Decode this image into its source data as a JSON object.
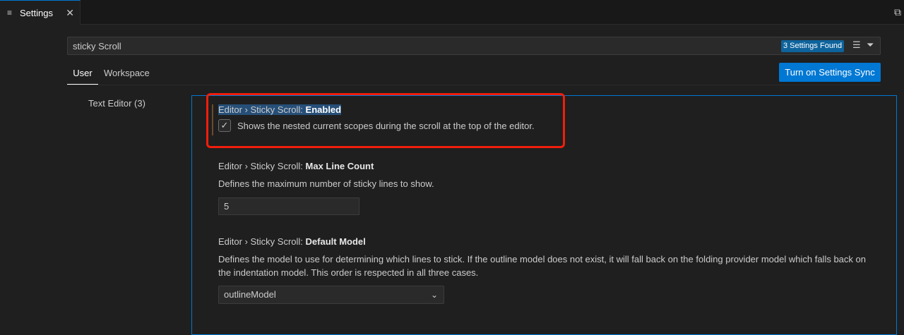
{
  "tab": {
    "icon": "settings-lines-icon",
    "label": "Settings",
    "close_icon": "close-icon"
  },
  "editor_actions": {
    "split_icon": "open-settings-json-icon"
  },
  "search": {
    "query": "sticky Scroll",
    "results_badge": "3 Settings Found",
    "clear_icon": "clear-filter-icon",
    "filter_icon": "filter-icon"
  },
  "scope_tabs": [
    {
      "label": "User",
      "active": true
    },
    {
      "label": "Workspace",
      "active": false
    }
  ],
  "sync_button": {
    "label": "Turn on Settings Sync"
  },
  "toc": [
    {
      "label": "Text Editor (3)"
    }
  ],
  "settings": [
    {
      "category": "Editor › Sticky Scroll: ",
      "name": "Enabled",
      "description": "Shows the nested current scopes during the scroll at the top of the editor.",
      "checked": true
    },
    {
      "category": "Editor › Sticky Scroll: ",
      "name": "Max Line Count",
      "description": "Defines the maximum number of sticky lines to show.",
      "value": "5"
    },
    {
      "category": "Editor › Sticky Scroll: ",
      "name": "Default Model",
      "description": "Defines the model to use for determining which lines to stick. If the outline model does not exist, it will fall back on the folding provider model which falls back on the indentation model. This order is respected in all three cases.",
      "value": "outlineModel"
    }
  ],
  "colors": {
    "accent": "#0078d4",
    "annotation_highlight": "#f01e0c",
    "background": "#1f1f1f"
  }
}
